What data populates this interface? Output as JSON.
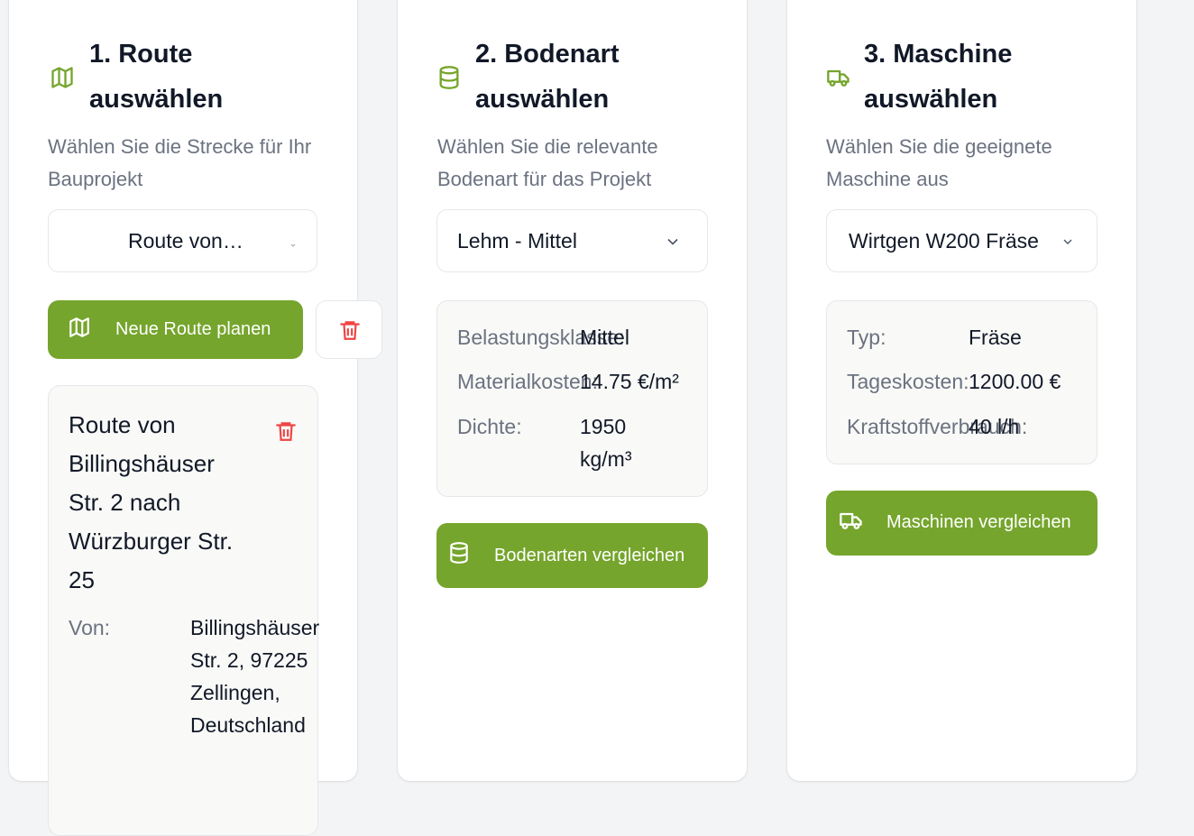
{
  "steps": [
    {
      "title": "1. Route auswählen",
      "subtitle": "Wählen Sie die Strecke für Ihr Bauprojekt",
      "icon": "map-icon",
      "select_value": "Route von…",
      "primary_button": "Neue Route planen",
      "route": {
        "title": "Route von Billingshäuser Str. 2 nach Würzburger Str. 25",
        "from_label": "Von:",
        "from_value": "Billingshäuser Str. 2, 97225 Zellingen, Deutschland"
      }
    },
    {
      "title": "2. Bodenart auswählen",
      "subtitle": "Wählen Sie die relevante Bodenart für das Projekt",
      "icon": "database-icon",
      "select_value": "Lehm - Mittel",
      "details": [
        {
          "label": "Belastungsklasse:",
          "value": "Mittel"
        },
        {
          "label": "Materialkosten:",
          "value": "14.75 €/m²"
        },
        {
          "label": "Dichte:",
          "value": "1950 kg/m³"
        }
      ],
      "primary_button": "Bodenarten vergleichen"
    },
    {
      "title": "3. Maschine auswählen",
      "subtitle": "Wählen Sie die geeignete Maschine aus",
      "icon": "truck-icon",
      "select_value": "Wirtgen W200 Fräse",
      "details": [
        {
          "label": "Typ:",
          "value": "Fräse"
        },
        {
          "label": "Tageskosten:",
          "value": "1200.00 €"
        },
        {
          "label": "Kraftstoffverbrauch:",
          "value": "40 l/h"
        }
      ],
      "primary_button": "Maschinen vergleichen"
    }
  ],
  "colors": {
    "accent": "#75a52c",
    "danger": "#ef4444",
    "text": "#111827",
    "muted": "#6b7280"
  }
}
